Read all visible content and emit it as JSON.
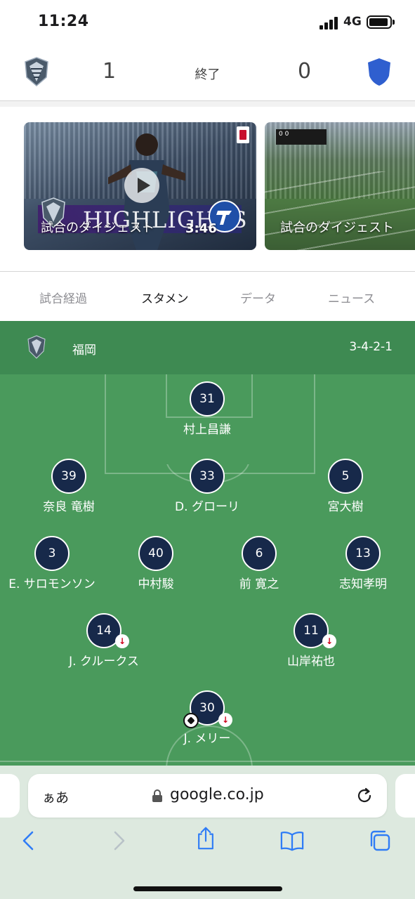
{
  "status_bar": {
    "time": "11:24",
    "network": "4G"
  },
  "match": {
    "home_score": "1",
    "status": "終了",
    "away_score": "0"
  },
  "videos": [
    {
      "title": "HIGHLIGHTS",
      "caption": "試合のダイジェスト",
      "duration": "3:46"
    },
    {
      "caption": "試合のダイジェスト",
      "scoreboard": "0 0"
    }
  ],
  "tabs": [
    {
      "label": "試合経過"
    },
    {
      "label": "スタメン"
    },
    {
      "label": "データ"
    },
    {
      "label": "ニュース"
    }
  ],
  "lineup": {
    "team": "福岡",
    "formation": "3-4-2-1",
    "players": [
      {
        "number": "31",
        "name": "村上昌謙"
      },
      {
        "number": "39",
        "name": "奈良 竜樹"
      },
      {
        "number": "33",
        "name": "D. グローリ"
      },
      {
        "number": "5",
        "name": "宮大樹"
      },
      {
        "number": "3",
        "name": "E. サロモンソン"
      },
      {
        "number": "40",
        "name": "中村駿"
      },
      {
        "number": "6",
        "name": "前 寛之"
      },
      {
        "number": "13",
        "name": "志知孝明"
      },
      {
        "number": "14",
        "name": "J. クルークス",
        "substituted": true
      },
      {
        "number": "11",
        "name": "山岸祐也",
        "substituted": true
      },
      {
        "number": "30",
        "name": "J. メリー",
        "substituted": true,
        "scored": true
      }
    ]
  },
  "browser": {
    "text_size_label": "ぁあ",
    "url": "google.co.jp"
  },
  "colors": {
    "pitch": "#4a9a5c",
    "lineup_header": "#3e8a52",
    "player_badge": "#17294a",
    "away_crest": "#2f5fcf"
  }
}
